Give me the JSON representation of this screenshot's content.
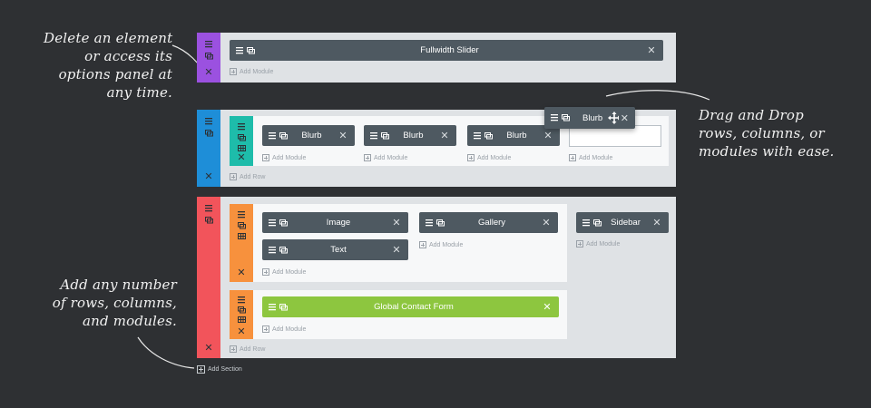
{
  "annotations": {
    "top_left": [
      "Delete an element",
      "or access its",
      "options panel at",
      "any time."
    ],
    "right": [
      "Drag and Drop",
      "rows, columns, or",
      "modules with ease."
    ],
    "bottom_left": [
      "Add any number",
      "of rows, columns,",
      "and modules."
    ]
  },
  "colors": {
    "background": "#2e3033",
    "section_1": "#9b51e0",
    "section_2": "#1e8ed8",
    "section_3": "#f2545b",
    "row_teal": "#1ebcaa",
    "row_orange": "#f7913d",
    "module": "#4e5961",
    "module_global": "#8dc63f"
  },
  "icons": {
    "menu": "hamburger-icon",
    "duplicate": "duplicate-icon",
    "columns": "columns-icon",
    "delete": "close-icon",
    "move": "move-arrows-icon",
    "add": "plus-square-icon"
  },
  "labels": {
    "add_module": "Add Module",
    "add_row": "Add Row",
    "add_section": "Add Section",
    "close_glyph": "✕"
  },
  "sections": {
    "s1": {
      "modules": [
        "Fullwidth Slider"
      ]
    },
    "s2": {
      "modules": [
        "Blurb",
        "Blurb",
        "Blurb"
      ],
      "dragging_module": "Blurb"
    },
    "s3": {
      "row1": {
        "col1": [
          "Image",
          "Text"
        ],
        "col2": [
          "Gallery"
        ]
      },
      "sidebar": [
        "Sidebar"
      ],
      "row2": {
        "global_module": "Global Contact Form"
      }
    }
  }
}
